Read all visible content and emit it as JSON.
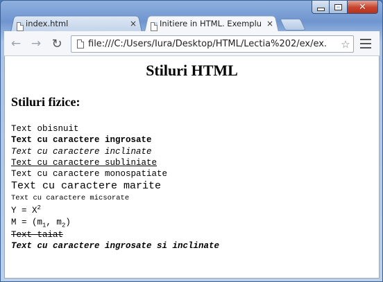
{
  "window": {
    "controls": {
      "minimize_icon": "minimize-icon",
      "maximize_icon": "maximize-icon",
      "close_glyph": "✕"
    }
  },
  "tabs": [
    {
      "title": "index.html",
      "close": "×",
      "active": false
    },
    {
      "title": "Initiere in HTML. Exemplu",
      "close": "×",
      "active": true
    }
  ],
  "toolbar": {
    "back_glyph": "←",
    "forward_glyph": "→",
    "reload_glyph": "↻",
    "url": "file:///C:/Users/Iura/Desktop/HTML/Lectia%202/ex/ex.",
    "star_glyph": "☆"
  },
  "page": {
    "heading": "Stiluri HTML",
    "subheading": "Stiluri fizice:",
    "lines": {
      "normal": "Text obisnuit",
      "bold": "Text cu caractere ingrosate",
      "italic": "Text cu caractere inclinate",
      "underline": "Text cu caractere subliniate",
      "mono": "Text cu caractere monospatiate",
      "big": "Text cu caractere marite",
      "small": "Text cu caractere micsorate",
      "sup_base": "Y = X",
      "sup_exp": "2",
      "sub_prefix": "M = (m",
      "sub_1": "1",
      "sub_mid": ", m",
      "sub_2": "2",
      "sub_suffix": ")",
      "strike": "Text taiat",
      "bold_italic": "Text cu caractere ingrosate si inclinate"
    }
  },
  "colors": {
    "frame": "#6f95cf",
    "close_button": "#c7432d",
    "page_background": "#ffffff"
  }
}
